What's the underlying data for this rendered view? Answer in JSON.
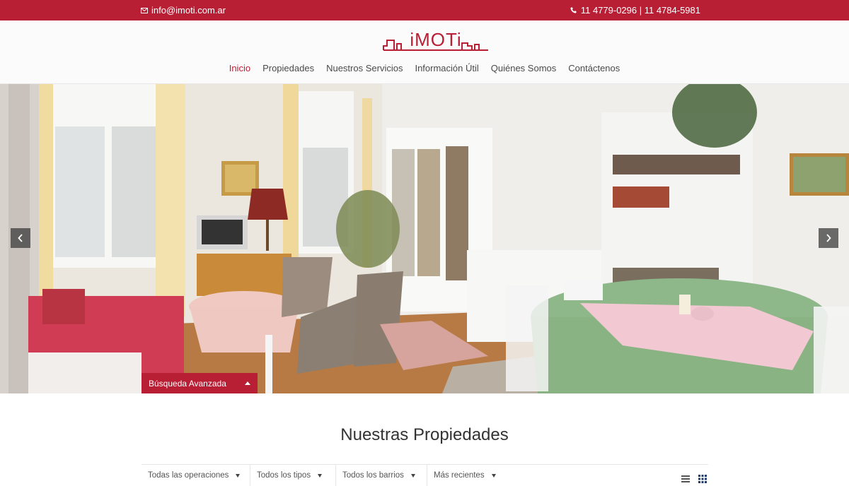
{
  "topbar": {
    "email": "info@imoti.com.ar",
    "phones": "11 4779-0296 | 11 4784-5981",
    "email_icon": "envelope-icon",
    "phone_icon": "phone-icon",
    "bg_color": "#b81f35"
  },
  "brand": {
    "name": "iMOTi",
    "color": "#b81f35"
  },
  "nav": {
    "items": [
      "Inicio",
      "Propiedades",
      "Nuestros Servicios",
      "Información Útil",
      "Quiénes Somos",
      "Contáctenos"
    ],
    "active": "Inicio"
  },
  "hero": {
    "prev_icon": "chevron-left-icon",
    "next_icon": "chevron-right-icon",
    "advanced_search_label": "Búsqueda Avanzada"
  },
  "section": {
    "title": "Nuestras Propiedades"
  },
  "filters": {
    "operation": "Todas las operaciones",
    "type": "Todos los tipos",
    "neighborhood": "Todos los barrios",
    "sort": "Más recientes"
  },
  "view_toggle": {
    "list_icon": "list-view-icon",
    "grid_icon": "grid-view-icon"
  }
}
